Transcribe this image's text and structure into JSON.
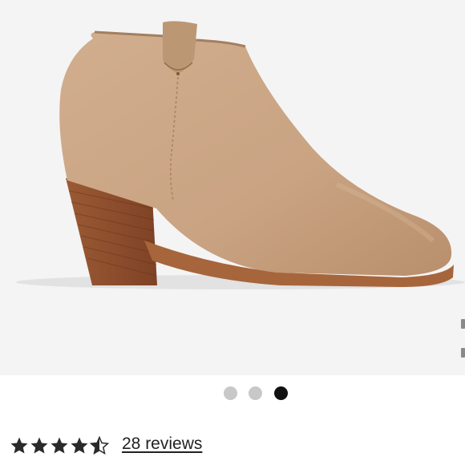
{
  "product_image": {
    "icon": "ankle-boot-image",
    "background_color": "#f4f4f4"
  },
  "carousel": {
    "dot_count": 3,
    "active_index": 2,
    "active_color": "#111111",
    "inactive_color": "#c8c8c8"
  },
  "rating": {
    "value": 4.5,
    "max": 5,
    "star_color": "#2a2a2a",
    "reviews_label": "28 reviews"
  }
}
